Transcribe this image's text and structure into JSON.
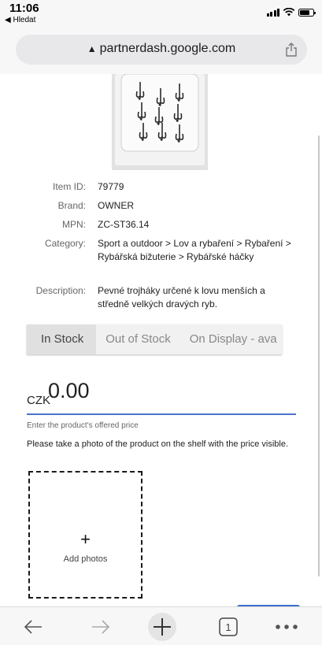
{
  "status_bar": {
    "time": "11:06",
    "back_app": "◀ Hledat",
    "signal_bars": 4,
    "battery_level": 0.75
  },
  "browser": {
    "url": "partnerdash.google.com",
    "lock_glyph": "▲",
    "open_tabs": "1"
  },
  "product": {
    "image_icon": "treble-hooks-image",
    "fields": [
      {
        "label": "Item ID:",
        "value": "79779"
      },
      {
        "label": "Brand:",
        "value": "OWNER"
      },
      {
        "label": "MPN:",
        "value": "ZC-ST36.14"
      },
      {
        "label": "Category:",
        "value": "Sport a outdoor > Lov a rybaření > Rybaření > Rybářská bižuterie > Rybářské háčky"
      },
      {
        "label": "Description:",
        "value": "Pevné trojháky určené k lovu menších a středně velkých dravých ryb."
      }
    ]
  },
  "tabs": [
    {
      "label": "In Stock",
      "active": true
    },
    {
      "label": "Out of Stock",
      "active": false
    },
    {
      "label": "On Display - ava",
      "active": false
    }
  ],
  "price": {
    "currency": "CZK",
    "value": "0.00",
    "hint": "Enter the product's offered price",
    "accent_color": "#4a72c8"
  },
  "photos": {
    "instructions": "Please take a photo of the product on the shelf with the price visible.",
    "plus": "+",
    "label": "Add photos"
  },
  "toolbar": {
    "icons": [
      "back-arrow-icon",
      "forward-arrow-icon",
      "new-tab-plus-icon",
      "tab-count-icon",
      "more-dots-icon"
    ]
  }
}
